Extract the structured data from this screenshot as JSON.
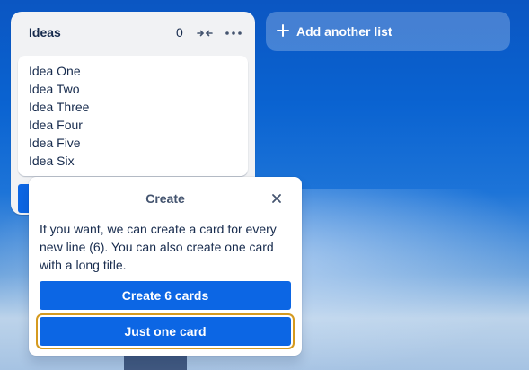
{
  "list": {
    "title": "Ideas",
    "count": "0",
    "collapse_icon": "collapse-arrows-icon",
    "more_icon": "more-horizontal-icon",
    "card_lines": [
      "Idea One",
      "Idea Two",
      "Idea Three",
      "Idea Four",
      "Idea Five",
      "Idea Six"
    ]
  },
  "add_list": {
    "icon": "plus-icon",
    "label": "Add another list"
  },
  "popover": {
    "title": "Create",
    "close_icon": "close-icon",
    "message": "If you want, we can create a card for every new line (6). You can also create one card with a long title.",
    "create_button": "Create 6 cards",
    "one_button": "Just one card"
  },
  "colors": {
    "primary": "#0c66e4",
    "focus_ring": "#d59a1f",
    "list_bg": "#f1f2f4",
    "text": "#172b4d"
  }
}
